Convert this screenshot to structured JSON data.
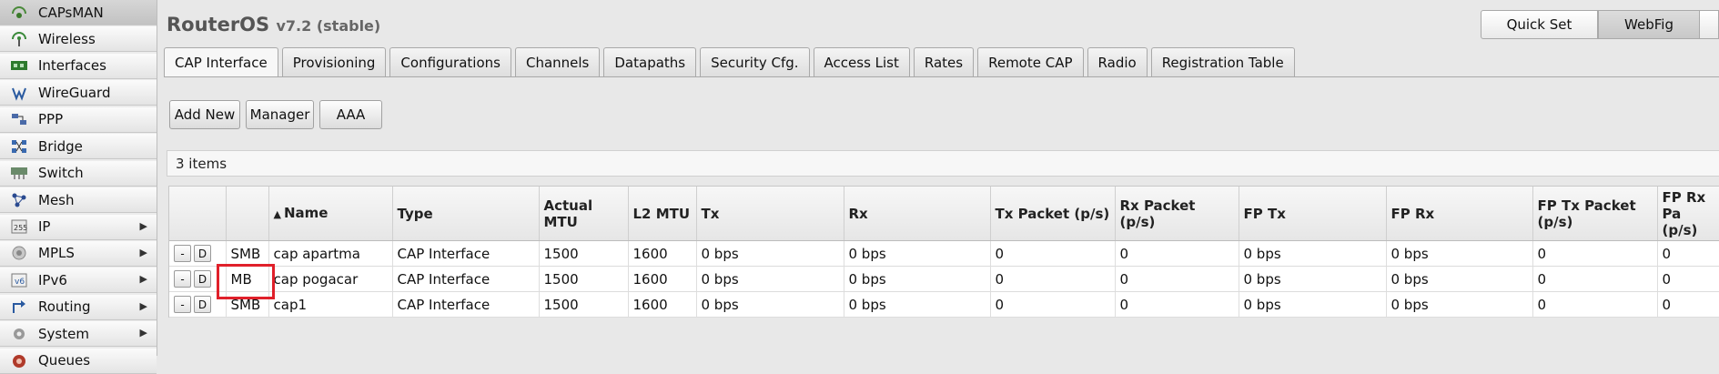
{
  "sidebar": {
    "items": [
      {
        "label": "CAPsMAN",
        "icon": "capsman-icon",
        "arrow": false,
        "active": true
      },
      {
        "label": "Wireless",
        "icon": "wireless-icon",
        "arrow": false
      },
      {
        "label": "Interfaces",
        "icon": "interfaces-icon",
        "arrow": false
      },
      {
        "label": "WireGuard",
        "icon": "wireguard-icon",
        "arrow": false
      },
      {
        "label": "PPP",
        "icon": "ppp-icon",
        "arrow": false
      },
      {
        "label": "Bridge",
        "icon": "bridge-icon",
        "arrow": false
      },
      {
        "label": "Switch",
        "icon": "switch-icon",
        "arrow": false
      },
      {
        "label": "Mesh",
        "icon": "mesh-icon",
        "arrow": false
      },
      {
        "label": "IP",
        "icon": "ip-icon",
        "arrow": true
      },
      {
        "label": "MPLS",
        "icon": "mpls-icon",
        "arrow": true
      },
      {
        "label": "IPv6",
        "icon": "ipv6-icon",
        "arrow": true
      },
      {
        "label": "Routing",
        "icon": "routing-icon",
        "arrow": true
      },
      {
        "label": "System",
        "icon": "system-icon",
        "arrow": true
      },
      {
        "label": "Queues",
        "icon": "queues-icon",
        "arrow": false
      }
    ],
    "arrow_glyph": "▶"
  },
  "header": {
    "title": "RouterOS",
    "version": "v7.2 (stable)"
  },
  "topbar": {
    "quick_set": "Quick Set",
    "webfig": "WebFig"
  },
  "tabs": [
    "CAP Interface",
    "Provisioning",
    "Configurations",
    "Channels",
    "Datapaths",
    "Security Cfg.",
    "Access List",
    "Rates",
    "Remote CAP",
    "Radio",
    "Registration Table"
  ],
  "actions": {
    "add_new": "Add New",
    "manager": "Manager",
    "aaa": "AAA"
  },
  "table": {
    "count_label": "3 items",
    "sort_indicator": "▲",
    "columns": [
      "",
      "",
      "Name",
      "Type",
      "Actual MTU",
      "L2 MTU",
      "Tx",
      "Rx",
      "Tx Packet (p/s)",
      "Rx Packet (p/s)",
      "FP Tx",
      "FP Rx",
      "FP Tx Packet (p/s)",
      "FP Rx Pa (p/s)"
    ],
    "row_buttons": {
      "minus": "-",
      "d": "D"
    },
    "rows": [
      {
        "flag": "SMB",
        "name": "cap apartma",
        "type": "CAP Interface",
        "actual_mtu": "1500",
        "l2_mtu": "1600",
        "tx": "0 bps",
        "rx": "0 bps",
        "tx_pkt": "0",
        "rx_pkt": "0",
        "fp_tx": "0 bps",
        "fp_rx": "0 bps",
        "fp_tx_pkt": "0",
        "fp_rx_pkt": "0"
      },
      {
        "flag": "MB",
        "name": "cap pogacar",
        "type": "CAP Interface",
        "actual_mtu": "1500",
        "l2_mtu": "1600",
        "tx": "0 bps",
        "rx": "0 bps",
        "tx_pkt": "0",
        "rx_pkt": "0",
        "fp_tx": "0 bps",
        "fp_rx": "0 bps",
        "fp_tx_pkt": "0",
        "fp_rx_pkt": "0"
      },
      {
        "flag": "SMB",
        "name": "cap1",
        "type": "CAP Interface",
        "actual_mtu": "1500",
        "l2_mtu": "1600",
        "tx": "0 bps",
        "rx": "0 bps",
        "tx_pkt": "0",
        "rx_pkt": "0",
        "fp_tx": "0 bps",
        "fp_rx": "0 bps",
        "fp_tx_pkt": "0",
        "fp_rx_pkt": "0"
      }
    ]
  },
  "colors": {
    "highlight": "#e0202a"
  }
}
